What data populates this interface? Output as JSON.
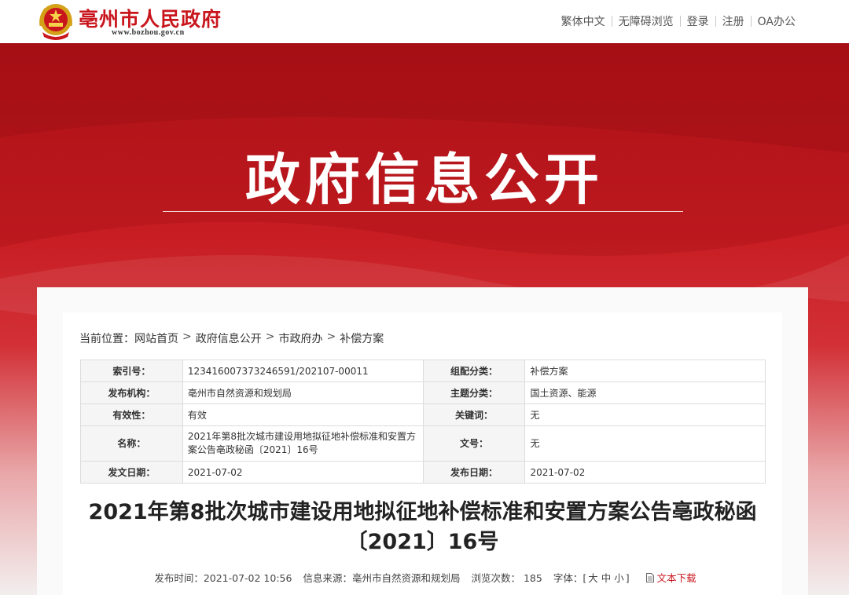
{
  "header": {
    "site_name": "亳州市人民政府",
    "site_url": "www.bozhou.gov.cn",
    "links": [
      "繁体中文",
      "无障碍浏览",
      "登录",
      "注册",
      "OA办公"
    ]
  },
  "banner": {
    "title": "政府信息公开"
  },
  "breadcrumb": {
    "prefix": "当前位置：",
    "items": [
      "网站首页",
      "政府信息公开",
      "市政府办",
      "补偿方案"
    ],
    "arrow": ">"
  },
  "meta": {
    "index_label": "索引号：",
    "index_value": "123416007373246591/202107-00011",
    "category_label": "组配分类：",
    "category_value": "补偿方案",
    "publisher_label": "发布机构：",
    "publisher_value": "亳州市自然资源和规划局",
    "topic_label": "主题分类：",
    "topic_value": "国土资源、能源",
    "validity_label": "有效性：",
    "validity_value": "有效",
    "keywords_label": "关键词：",
    "keywords_value": "无",
    "name_label": "名称：",
    "name_value": "2021年第8批次城市建设用地拟征地补偿标准和安置方案公告亳政秘函〔2021〕16号",
    "docno_label": "文号：",
    "docno_value": "无",
    "issue_date_label": "发文日期：",
    "issue_date_value": "2021-07-02",
    "publish_date_label": "发布日期：",
    "publish_date_value": "2021-07-02"
  },
  "article": {
    "title": "2021年第8批次城市建设用地拟征地补偿标准和安置方案公告亳政秘函〔2021〕16号",
    "publish_time": "发布时间：2021-07-02 10:56",
    "source": "信息来源：亳州市自然资源和规划局",
    "views_label": "浏览次数：",
    "views": "185",
    "font_label": "字体：[",
    "font_large": "大",
    "font_medium": "中",
    "font_small": "小",
    "font_close": "]",
    "download": "文本下载"
  },
  "colors": {
    "brand_red": "#c9161d",
    "banner_red": "#c71d23"
  },
  "icons": {
    "emblem": "national-emblem-icon",
    "download": "document-icon"
  }
}
